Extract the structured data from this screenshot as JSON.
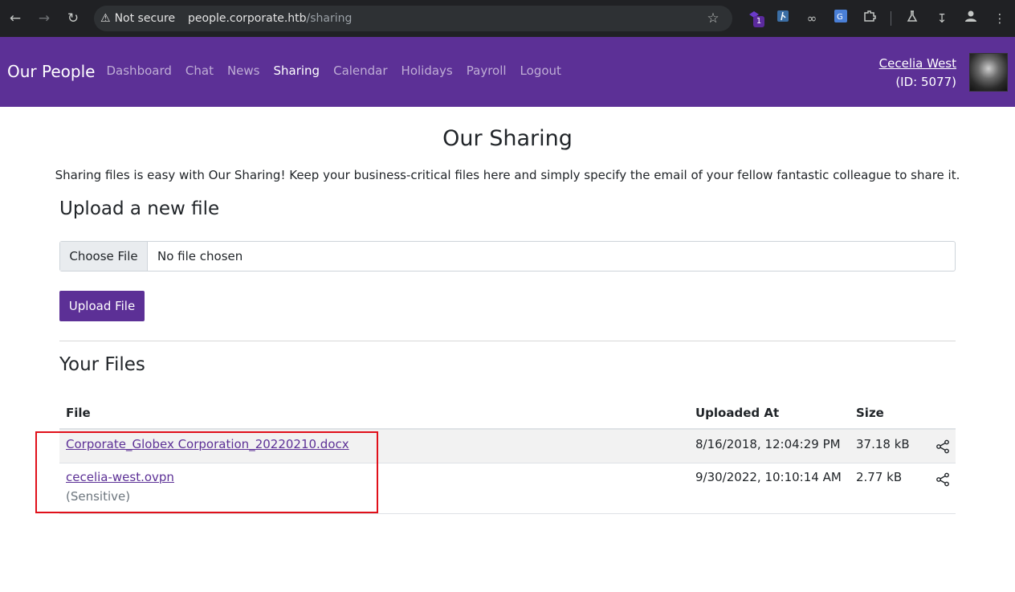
{
  "browser": {
    "security_label": "Not secure",
    "url_host": "people.corporate.htb",
    "url_path": "/sharing",
    "extension_badge": "1"
  },
  "navbar": {
    "brand": "Our People",
    "links": [
      {
        "label": "Dashboard",
        "active": false
      },
      {
        "label": "Chat",
        "active": false
      },
      {
        "label": "News",
        "active": false
      },
      {
        "label": "Sharing",
        "active": true
      },
      {
        "label": "Calendar",
        "active": false
      },
      {
        "label": "Holidays",
        "active": false
      },
      {
        "label": "Payroll",
        "active": false
      },
      {
        "label": "Logout",
        "active": false
      }
    ],
    "user": {
      "name": "Cecelia West",
      "id_text": "(ID: 5077)"
    }
  },
  "main": {
    "title": "Our Sharing",
    "intro": "Sharing files is easy with Our Sharing! Keep your business-critical files here and simply specify the email of your fellow fantastic colleague to share it.",
    "upload_heading": "Upload a new file",
    "choose_file_label": "Choose File",
    "no_file_text": "No file chosen",
    "upload_button": "Upload File",
    "files_heading": "Your Files",
    "table": {
      "headers": {
        "file": "File",
        "uploaded_at": "Uploaded At",
        "size": "Size"
      },
      "rows": [
        {
          "file": "Corporate_Globex Corporation_20220210.docx",
          "note": "",
          "uploaded_at": "8/16/2018, 12:04:29 PM",
          "size": "37.18 kB"
        },
        {
          "file": "cecelia-west.ovpn",
          "note": "(Sensitive)",
          "uploaded_at": "9/30/2022, 10:10:14 AM",
          "size": "2.77 kB"
        }
      ]
    }
  },
  "colors": {
    "brand_purple": "#5c3096",
    "highlight_red": "#e0101a"
  }
}
